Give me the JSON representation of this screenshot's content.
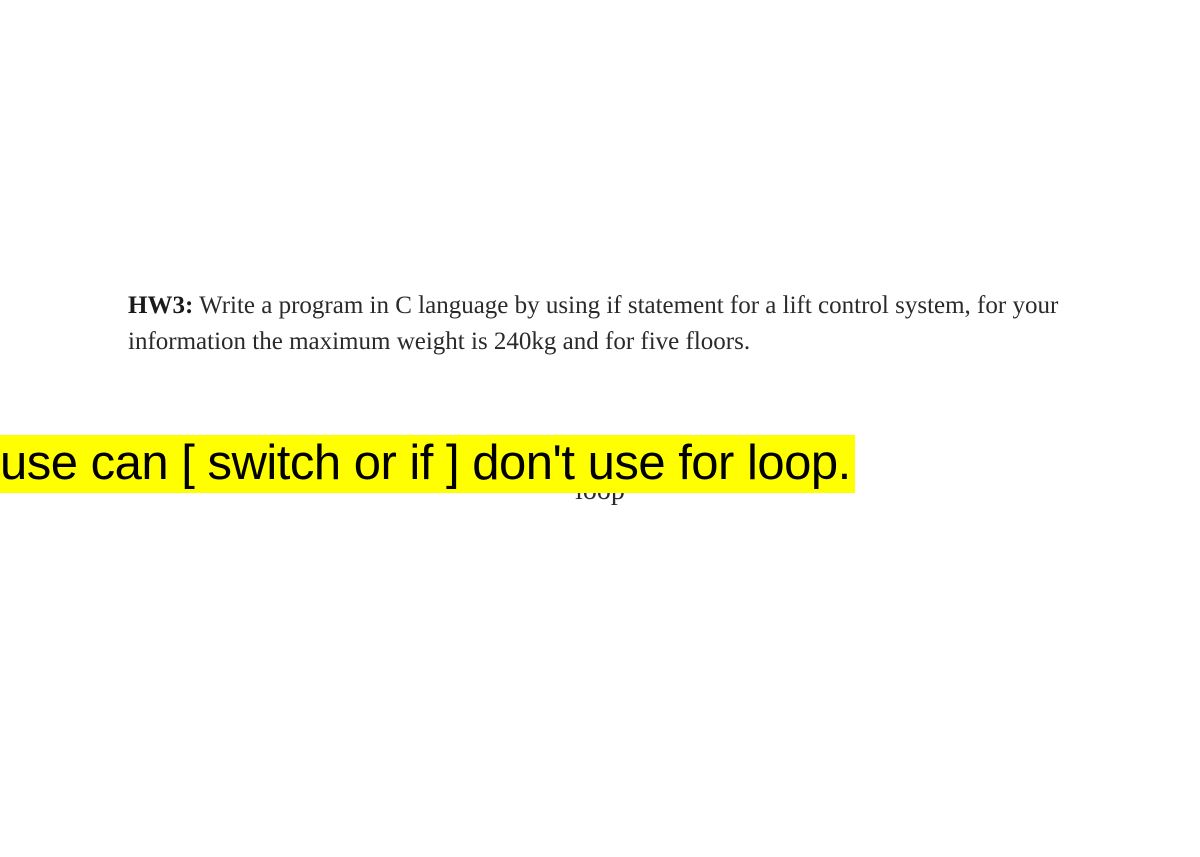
{
  "document": {
    "question": {
      "label": "HW3:",
      "text": "Write a program in C language by using if statement for a lift control system, for your information the maximum weight is 240kg and for five floors."
    },
    "obscured": "loop",
    "highlight": "use can [ switch or if ] don't use for loop."
  }
}
